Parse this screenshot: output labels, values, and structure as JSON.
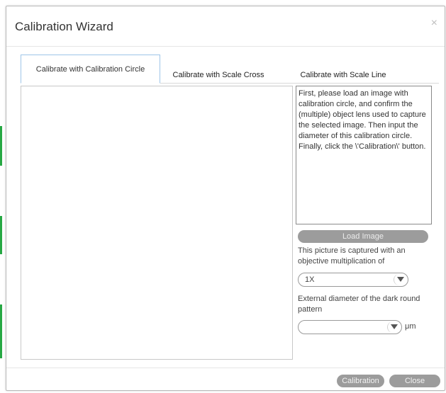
{
  "dialog": {
    "title": "Calibration Wizard",
    "close_glyph": "×"
  },
  "tabs": [
    {
      "label": "Calibrate with Calibration Circle",
      "active": true
    },
    {
      "label": "Calibrate with Scale Cross",
      "active": false
    },
    {
      "label": "Calibrate with Scale Line",
      "active": false
    }
  ],
  "instructions": "First, please load an image with calibration circle, and confirm the (multiple) object lens used to capture the selected image. Then input the diameter of this calibration circle. Finally, click the \\'Calibration\\' button.",
  "load_image_label": "Load Image",
  "objective": {
    "label": "This picture is captured with an objective multiplication of",
    "selected_value": "1X"
  },
  "diameter": {
    "label": "External diameter of the dark round pattern",
    "value": "",
    "unit": "μm"
  },
  "footer": {
    "calibration_label": "Calibration",
    "close_label": "Close"
  },
  "colors": {
    "button_gray": "#9c9c9c",
    "active_tab_border": "#9ec5e8",
    "edge_green": "#27a844"
  },
  "icons": {
    "close": "close-icon",
    "dropdown": "triangle-down-icon"
  }
}
